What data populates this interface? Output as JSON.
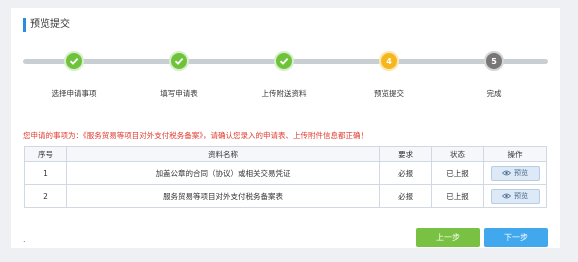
{
  "panel": {
    "title": "预览提交"
  },
  "steps": [
    {
      "label": "选择申请事项",
      "state": "done",
      "number": ""
    },
    {
      "label": "填写申请表",
      "state": "done",
      "number": ""
    },
    {
      "label": "上传附送资料",
      "state": "done",
      "number": ""
    },
    {
      "label": "预览提交",
      "state": "current",
      "number": "4"
    },
    {
      "label": "完成",
      "state": "todo",
      "number": "5"
    }
  ],
  "notice": "您申请的事项为：《服务贸易等项目对外支付税务备案》，请确认您录入的申请表、上传附件信息都正确！",
  "table": {
    "headers": [
      "序号",
      "资料名称",
      "要求",
      "状态",
      "操作"
    ],
    "rows": [
      {
        "no": "1",
        "name": "加盖公章的合同（协议）或相关交易凭证",
        "requirement": "必报",
        "status": "已上报",
        "action": "预览"
      },
      {
        "no": "2",
        "name": "服务贸易等项目对外支付税务备案表",
        "requirement": "必报",
        "status": "已上报",
        "action": "预览"
      }
    ]
  },
  "footer": {
    "dot": ".",
    "prev_label": "上一步",
    "next_label": "下一步"
  },
  "colors": {
    "accent": "#2b8de0",
    "done": "#6ec33a",
    "current": "#f6b71c",
    "todo": "#777777",
    "warning": "#e03a2e",
    "prev": "#79c142",
    "next": "#41a8ee"
  }
}
